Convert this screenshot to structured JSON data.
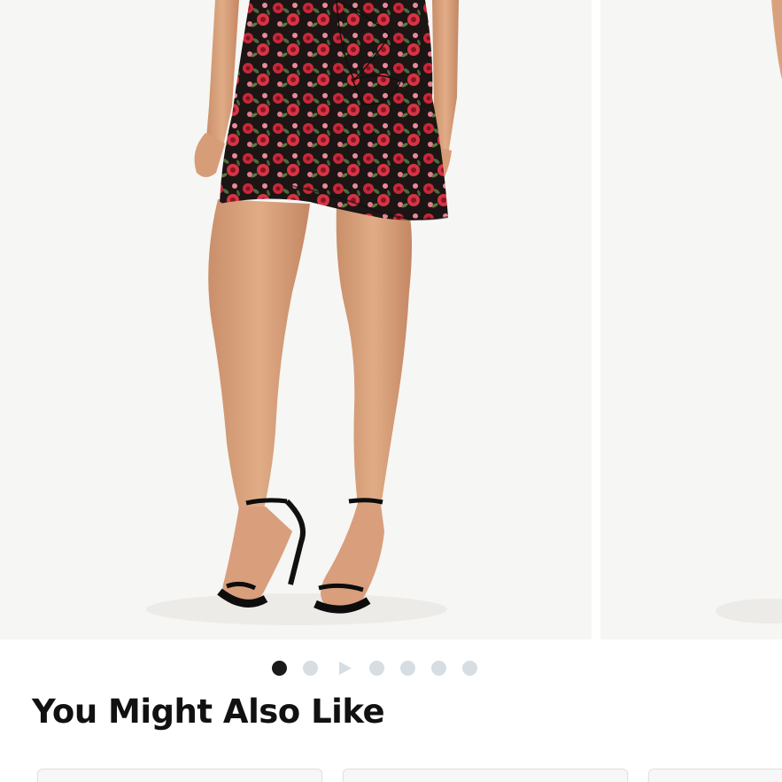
{
  "carousel": {
    "slides": [
      {
        "name": "product-image-main"
      },
      {
        "name": "product-image-next"
      }
    ],
    "dots": [
      {
        "type": "image",
        "active": true
      },
      {
        "type": "image",
        "active": false
      },
      {
        "type": "video",
        "active": false
      },
      {
        "type": "image",
        "active": false
      },
      {
        "type": "image",
        "active": false
      },
      {
        "type": "image",
        "active": false
      },
      {
        "type": "image",
        "active": false
      }
    ],
    "colors": {
      "background": "#f6f6f4",
      "dot_active": "#1a1a1a",
      "dot_inactive": "#d6dde3"
    }
  },
  "recommendations": {
    "title": "You Might Also Like",
    "cards": [
      {},
      {},
      {}
    ]
  }
}
